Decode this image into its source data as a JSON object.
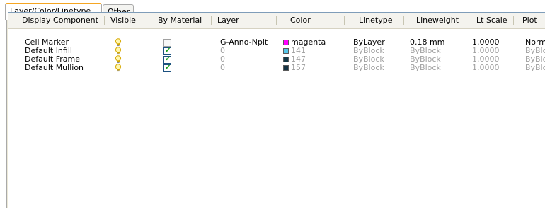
{
  "tabs": [
    {
      "label": "Layer/Color/Linetype",
      "active": true
    },
    {
      "label": "Other",
      "active": false
    }
  ],
  "columns": [
    "Display Component",
    "Visible",
    "By Material",
    "Layer",
    "Color",
    "Linetype",
    "Lineweight",
    "Lt Scale",
    "Plot"
  ],
  "rows": [
    {
      "component": "Cell Marker",
      "visible": "bulb-on-icon",
      "by_material": false,
      "layer": "G-Anno-Nplt",
      "color_name": "magenta",
      "color_hex": "#ff00ff",
      "linetype": "ByLayer",
      "lineweight": "0.18 mm",
      "lt_scale": "1.0000",
      "plot": "Norm"
    },
    {
      "component": "Default Infill",
      "visible": "bulb-on-icon",
      "by_material": true,
      "layer": "0",
      "color_name": "141",
      "color_hex": "#55c7ea",
      "linetype": "ByBlock",
      "lineweight": "ByBlock",
      "lt_scale": "1.0000",
      "plot": "ByBlo"
    },
    {
      "component": "Default Frame",
      "visible": "bulb-on-icon",
      "by_material": true,
      "layer": "0",
      "color_name": "147",
      "color_hex": "#153a48",
      "linetype": "ByBlock",
      "lineweight": "ByBlock",
      "lt_scale": "1.0000",
      "plot": "ByBlo"
    },
    {
      "component": "Default Mullion",
      "visible": "bulb-on-icon",
      "by_material": true,
      "layer": "0",
      "color_name": "157",
      "color_hex": "#133344",
      "linetype": "ByBlock",
      "lineweight": "ByBlock",
      "lt_scale": "1.0000",
      "plot": "ByBlo"
    }
  ],
  "colors": {
    "tab_accent": "#f5a623",
    "panel_bg": "#ece9d8",
    "header_bg": "#f4f3ee",
    "dim_text": "#a0a0a0"
  }
}
